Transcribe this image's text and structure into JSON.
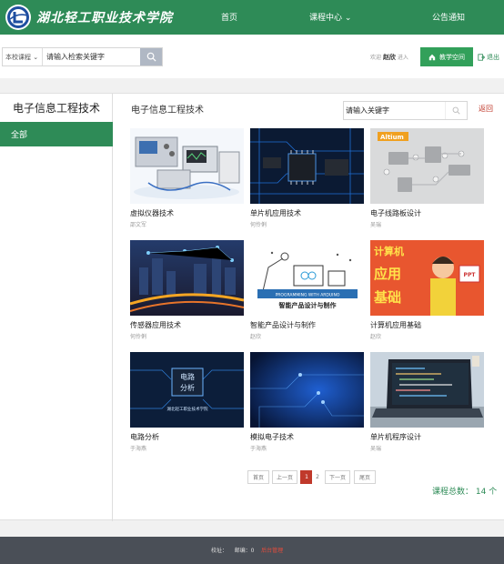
{
  "header": {
    "school_name": "湖北轻工职业技术学院",
    "nav": {
      "home": "首页",
      "course_center": "课程中心",
      "notice": "公告通知"
    },
    "brand_color": "#2e8b57"
  },
  "search": {
    "scope": "本校课程",
    "value": "请输入检索关键字"
  },
  "user": {
    "welcome": "欢迎",
    "name": "赵欣",
    "enter": "进入",
    "space_button": "教学空间",
    "logout": "退出"
  },
  "sidebar": {
    "title": "电子信息工程技术",
    "items": [
      {
        "label": "全部"
      }
    ]
  },
  "content": {
    "title": "电子信息工程技术",
    "keyword_value": "请输入关键字",
    "back": "返回"
  },
  "courses": [
    {
      "title": "虚拟仪器技术",
      "teacher": "邵文军"
    },
    {
      "title": "单片机应用技术",
      "teacher": "何伶俐"
    },
    {
      "title": "电子线路板设计",
      "teacher": "吴瑞"
    },
    {
      "title": "传感器应用技术",
      "teacher": "何伶俐"
    },
    {
      "title": "智能产品设计与制作",
      "teacher": "赵欣"
    },
    {
      "title": "计算机应用基础",
      "teacher": "赵欣"
    },
    {
      "title": "电路分析",
      "teacher": "于海燕"
    },
    {
      "title": "模拟电子技术",
      "teacher": "于海燕"
    },
    {
      "title": "单片机程序设计",
      "teacher": "吴瑞"
    }
  ],
  "thumb_text": {
    "altium": "Altium",
    "arduino": "PROGRAMMING WITH ARDUINO",
    "smart": "智能产品设计与制作",
    "computer_1": "计算机",
    "computer_2": "应用",
    "computer_3": "基础",
    "ppt": "PPT",
    "circuit_1": "电路",
    "circuit_2": "分析",
    "circuit_school": "湖北轻工职业技术学院"
  },
  "pagination": {
    "first": "首页",
    "prev": "上一页",
    "pages": [
      "1",
      "2"
    ],
    "current": "1",
    "next": "下一页",
    "last": "尾页"
  },
  "total": {
    "label": "课程总数：",
    "count": "14 个"
  },
  "footer": {
    "address_label": "校址：",
    "zip_label": "邮编：0",
    "admin": "后台管理"
  }
}
